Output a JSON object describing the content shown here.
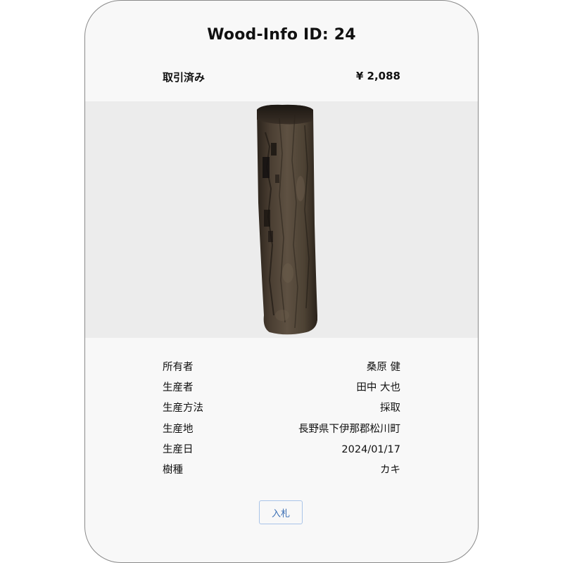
{
  "title": "Wood-Info ID: 24",
  "status": {
    "label": "取引済み",
    "price": "¥ 2,088"
  },
  "image": {
    "subject": "log-of-wood"
  },
  "info": [
    {
      "label": "所有者",
      "value": "桑原 健"
    },
    {
      "label": "生産者",
      "value": "田中 大也"
    },
    {
      "label": "生産方法",
      "value": "採取"
    },
    {
      "label": "生産地",
      "value": "長野県下伊那郡松川町"
    },
    {
      "label": "生産日",
      "value": "2024/01/17"
    },
    {
      "label": "樹種",
      "value": "カキ"
    }
  ],
  "bid_button": {
    "label": "入札"
  },
  "colors": {
    "card_background": "#f8f8f8",
    "image_background": "#ececec",
    "button_text": "#3b6fb5",
    "button_border": "#a9c4e8"
  }
}
